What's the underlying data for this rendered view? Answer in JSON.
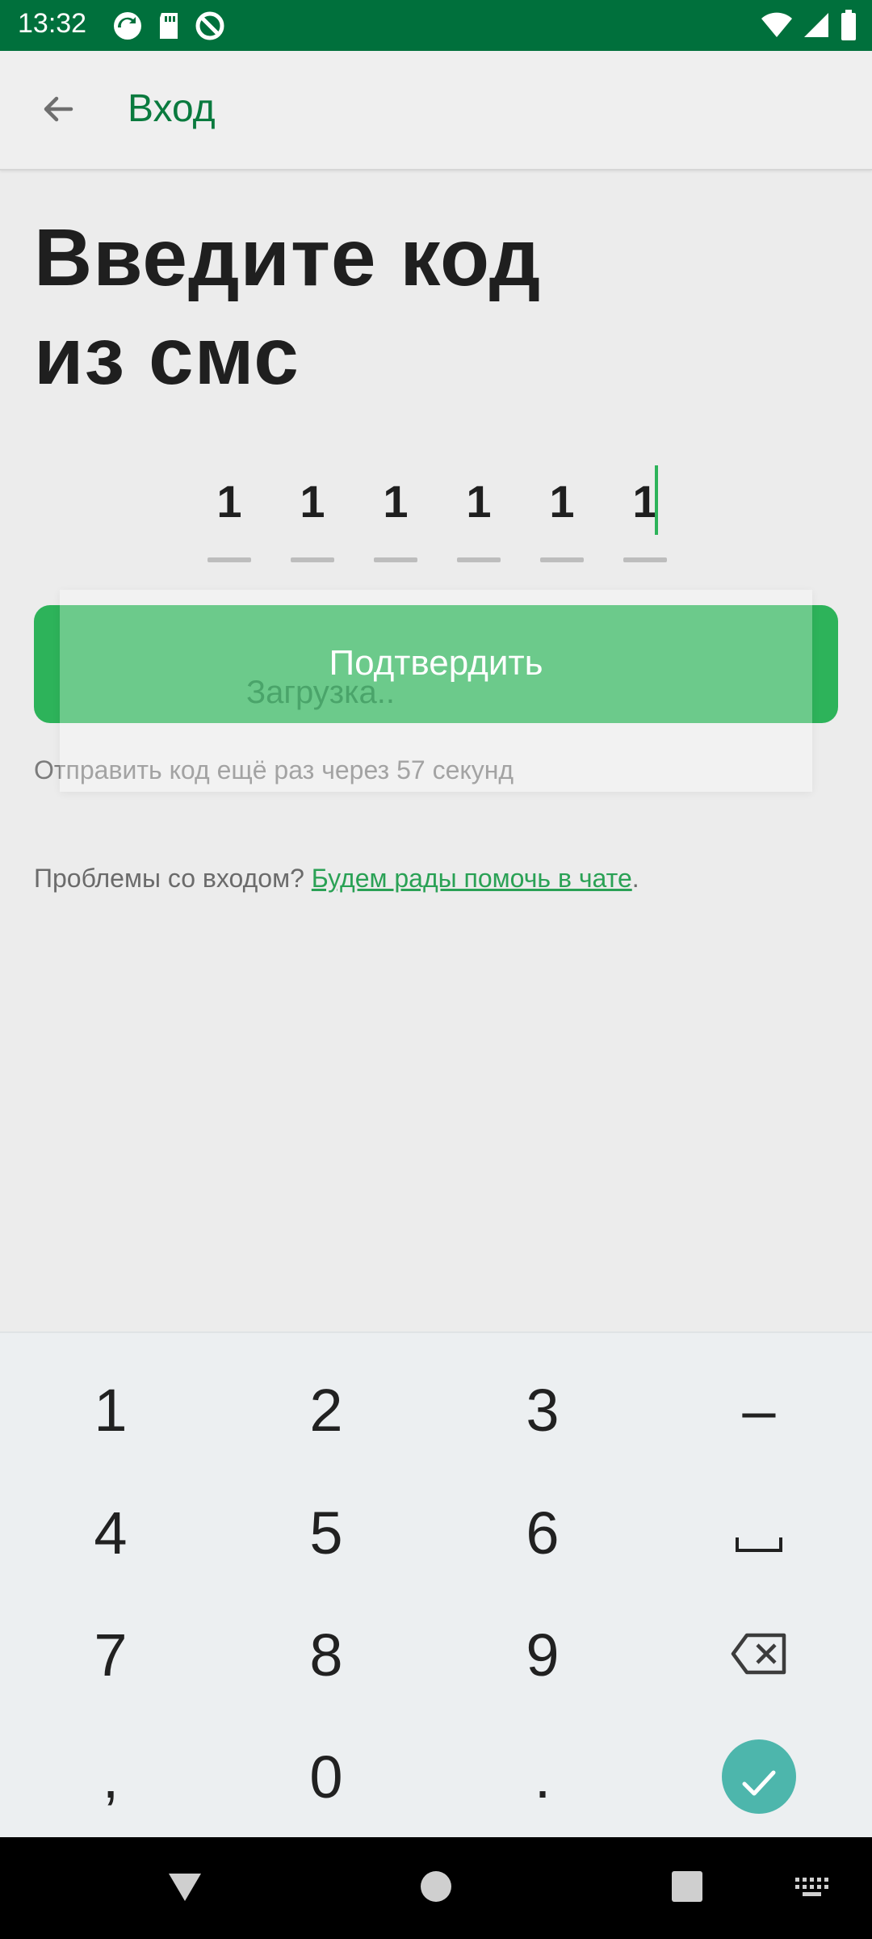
{
  "status_bar": {
    "time": "13:32",
    "notification_icons": [
      "sync-icon",
      "sd-card-icon",
      "no-disturb-icon"
    ],
    "system_icons": [
      "wifi-icon",
      "signal-icon",
      "battery-icon"
    ]
  },
  "app_bar": {
    "back_icon": "arrow-left-icon",
    "title": "Вход"
  },
  "heading": {
    "line1": "Введите код",
    "line2": "из смс"
  },
  "code_input": {
    "digits": [
      "1",
      "1",
      "1",
      "1",
      "1",
      "1"
    ]
  },
  "confirm_button": {
    "label": "Подтвердить"
  },
  "loading": {
    "text": "Загрузка.."
  },
  "resend_text": "Отправить код ещё раз через 57 секунд",
  "help": {
    "prefix": "Проблемы со входом? ",
    "link": "Будем рады помочь в чате",
    "suffix": "."
  },
  "keyboard": {
    "keys": [
      "1",
      "2",
      "3",
      "–",
      "4",
      "5",
      "6",
      "␣",
      "7",
      "8",
      "9",
      "⌫",
      ",",
      "0",
      ".",
      "✓"
    ]
  },
  "colors": {
    "status_bar": "#00703c",
    "accent": "#2db35a",
    "title_green": "#0a7a3e",
    "keyboard_enter": "#4db6ac"
  }
}
